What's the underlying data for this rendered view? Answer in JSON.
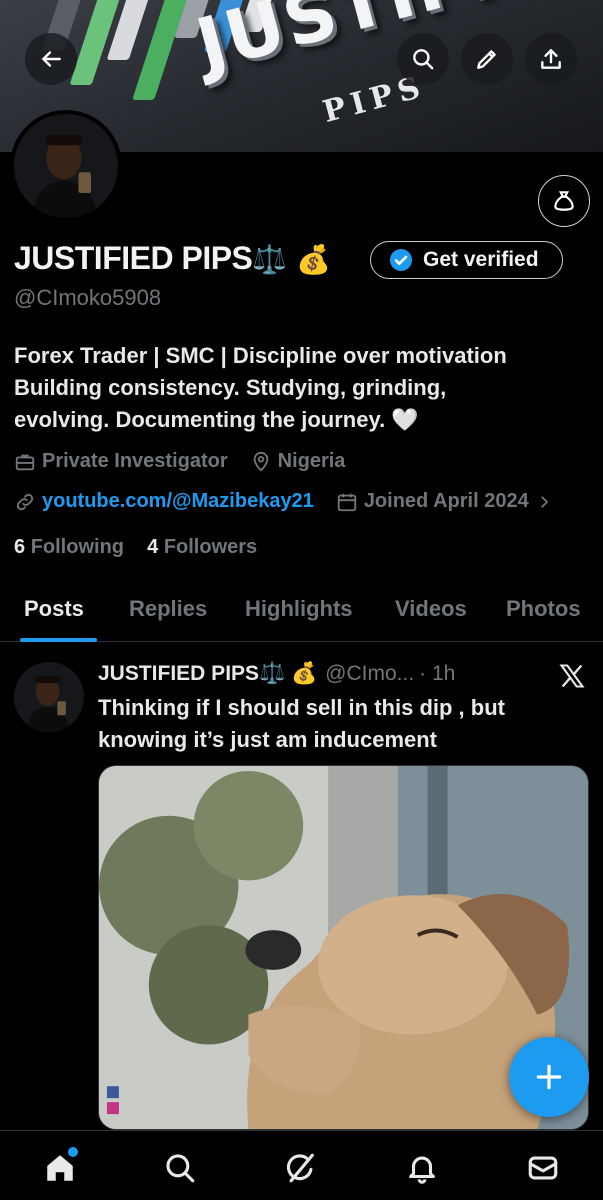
{
  "banner": {
    "title": "JUSTIFIED",
    "subtitle": "PIPS"
  },
  "header_buttons": {
    "back": "back-icon",
    "search": "search-icon",
    "edit": "edit-icon",
    "share": "share-icon"
  },
  "profile": {
    "name": "JUSTIFIED PIPS",
    "emoji": "⚖️ 💰",
    "handle": "@CImoko5908",
    "get_verified_label": "Get verified",
    "bio_line1": "Forex Trader | SMC | Discipline over motivation",
    "bio_line2": "Building consistency. Studying, grinding,",
    "bio_line3": "evolving. Documenting the journey. 🤍",
    "category": "Private Investigator",
    "location": "Nigeria",
    "website": "youtube.com/@Mazibekay21",
    "joined": "Joined April 2024",
    "following_count": "6",
    "following_label": "Following",
    "followers_count": "4",
    "followers_label": "Followers"
  },
  "tabs": [
    {
      "label": "Posts",
      "active": true
    },
    {
      "label": "Replies"
    },
    {
      "label": "Highlights"
    },
    {
      "label": "Videos"
    },
    {
      "label": "Photos"
    }
  ],
  "post": {
    "author_name": "JUSTIFIED PIPS⚖️ 💰",
    "author_handle": "@CImo...",
    "time": "· 1h",
    "text_line1": "Thinking if I should sell in this dip , but",
    "text_line2": "knowing it’s just am inducement"
  },
  "colors": {
    "accent": "#1d9bf0",
    "background": "#000000",
    "muted": "#71767b"
  }
}
